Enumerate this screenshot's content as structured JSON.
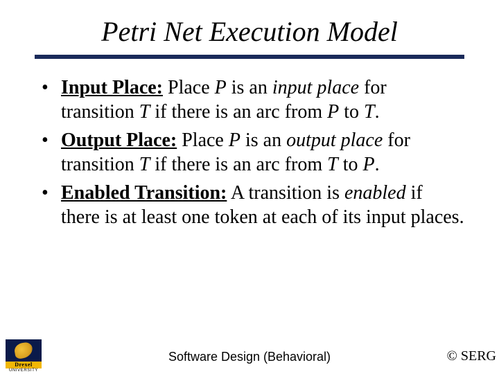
{
  "title": "Petri Net Execution Model",
  "bullets": [
    {
      "term": "Input Place:",
      "before": "Place ",
      "v1": "P",
      "mid1": " is an ",
      "em": "input place",
      "mid2": " for transition ",
      "v2": "T",
      "mid3": " if there is an arc from ",
      "v3": "P",
      "mid4": " to ",
      "v4": "T",
      "after": "."
    },
    {
      "term": "Output Place:",
      "before": "Place ",
      "v1": "P",
      "mid1": " is an ",
      "em": "output place",
      "mid2": " for transition ",
      "v2": "T",
      "mid3": " if there is an arc from ",
      "v3": "T",
      "mid4": " to ",
      "v4": "P",
      "after": "."
    },
    {
      "term": "Enabled Transition:",
      "before": "A transition is ",
      "em": "enabled",
      "mid1": " if there is at least one token at each of its input places.",
      "v1": "",
      "mid2": "",
      "v2": "",
      "mid3": "",
      "v3": "",
      "mid4": "",
      "v4": "",
      "after": ""
    }
  ],
  "logo": {
    "name": "Drexel",
    "sub": "UNIVERSITY"
  },
  "footer": {
    "center": "Software Design (Behavioral)",
    "right": "© SERG"
  },
  "dot": "•"
}
